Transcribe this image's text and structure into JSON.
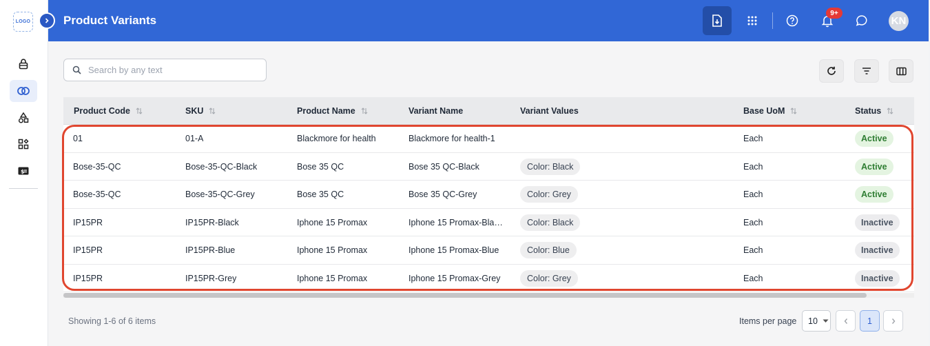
{
  "app": {
    "logo_text": "LOGO",
    "page_title": "Product Variants",
    "avatar_initials": "KN",
    "notification_badge": "9+"
  },
  "sidebar": {
    "items": [
      {
        "icon": "lock-icon"
      },
      {
        "icon": "variants-icon",
        "active": true
      },
      {
        "icon": "shapes-icon"
      },
      {
        "icon": "grid-plus-icon"
      },
      {
        "icon": "currency-icon"
      }
    ]
  },
  "toolbar": {
    "search_placeholder": "Search by any text"
  },
  "table": {
    "columns": [
      "Product Code",
      "SKU",
      "Product Name",
      "Variant Name",
      "Variant Values",
      "Base UoM",
      "Status"
    ],
    "rows": [
      {
        "code": "01",
        "sku": "01-A",
        "name": "Blackmore for health",
        "variant": "Blackmore for health-1",
        "values": "",
        "uom": "Each",
        "status": "Active"
      },
      {
        "code": "Bose-35-QC",
        "sku": "Bose-35-QC-Black",
        "name": "Bose 35 QC",
        "variant": "Bose 35 QC-Black",
        "values": "Color: Black",
        "uom": "Each",
        "status": "Active"
      },
      {
        "code": "Bose-35-QC",
        "sku": "Bose-35-QC-Grey",
        "name": "Bose 35 QC",
        "variant": "Bose 35 QC-Grey",
        "values": "Color: Grey",
        "uom": "Each",
        "status": "Active"
      },
      {
        "code": "IP15PR",
        "sku": "IP15PR-Black",
        "name": "Iphone 15 Promax",
        "variant": "Iphone 15 Promax-Bla…",
        "values": "Color: Black",
        "uom": "Each",
        "status": "Inactive"
      },
      {
        "code": "IP15PR",
        "sku": "IP15PR-Blue",
        "name": "Iphone 15 Promax",
        "variant": "Iphone 15 Promax-Blue",
        "values": "Color: Blue",
        "uom": "Each",
        "status": "Inactive"
      },
      {
        "code": "IP15PR",
        "sku": "IP15PR-Grey",
        "name": "Iphone 15 Promax",
        "variant": "Iphone 15 Promax-Grey",
        "values": "Color: Grey",
        "uom": "Each",
        "status": "Inactive"
      }
    ]
  },
  "pagination": {
    "showing_text": "Showing 1-6 of 6 items",
    "items_per_page_label": "Items per page",
    "items_per_page": "10",
    "current_page": "1"
  },
  "colors": {
    "header": "#3167d6",
    "highlight": "#e0462f",
    "active_status": "#2e7d32"
  }
}
